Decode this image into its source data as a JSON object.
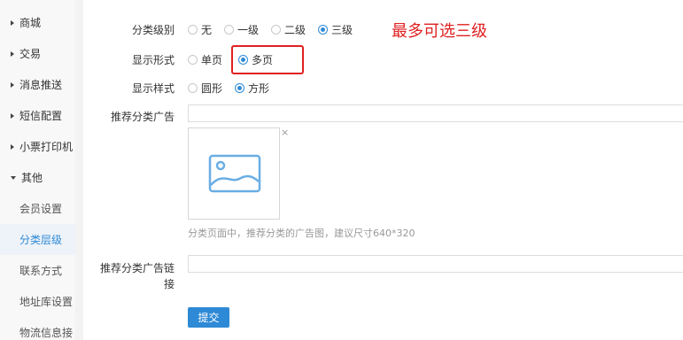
{
  "sidebar": {
    "groups": [
      {
        "label": "商城"
      },
      {
        "label": "交易"
      },
      {
        "label": "消息推送"
      },
      {
        "label": "短信配置"
      },
      {
        "label": "小票打印机"
      },
      {
        "label": "其他"
      }
    ],
    "sub_items": [
      {
        "label": "会员设置"
      },
      {
        "label": "分类层级"
      },
      {
        "label": "联系方式"
      },
      {
        "label": "地址库设置"
      },
      {
        "label": "物流信息接"
      }
    ]
  },
  "form": {
    "level": {
      "label": "分类级别",
      "options": [
        "无",
        "一级",
        "二级",
        "三级"
      ],
      "selected": "三级"
    },
    "display_mode": {
      "label": "显示形式",
      "options": [
        "单页",
        "多页"
      ],
      "selected": "多页"
    },
    "display_style": {
      "label": "显示样式",
      "options": [
        "圆形",
        "方形"
      ],
      "selected": "方形"
    },
    "ad": {
      "label": "推荐分类广告",
      "value": "",
      "hint": "分类页面中，推荐分类的广告图，建议尺寸640*320",
      "remove_glyph": "×"
    },
    "ad_link": {
      "label_line1": "推荐分类广告链",
      "label_line2": "接",
      "value": ""
    },
    "submit_label": "提交"
  },
  "annotation": "最多可选三级",
  "colors": {
    "accent": "#2e8ad6",
    "annotation": "#e02020"
  }
}
